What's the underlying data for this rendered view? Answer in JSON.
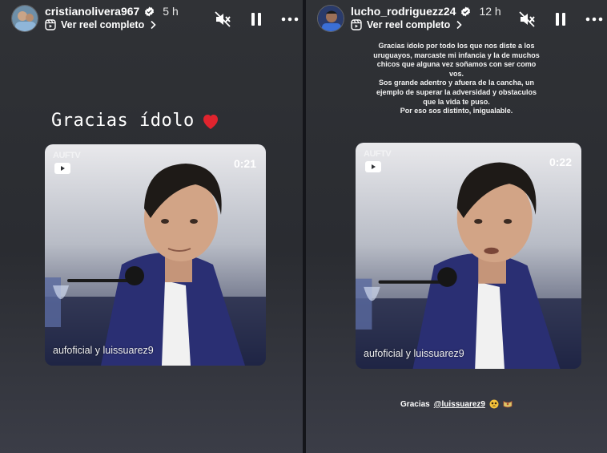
{
  "stories": [
    {
      "username": "cristianolivera967",
      "time": "5 h",
      "reel_link": "Ver reel completo",
      "headline": "Gracias ídolo",
      "video": {
        "logo": "AUFTV",
        "duration": "0:21",
        "credit": "aufoficial y luissuarez9"
      }
    },
    {
      "username": "lucho_rodriguezz24",
      "time": "12 h",
      "reel_link": "Ver reel completo",
      "caption": [
        "Gracias idolo por todo los que nos diste a los",
        "uruguayos, marcaste mi infancia y la de muchos",
        "chicos que alguna vez soñamos con ser como",
        "vos.",
        "Sos grande adentro y afuera de la cancha, un",
        "ejemplo de superar la adversidad y obstaculos",
        "que la vida te puso.",
        "Por eso sos distinto, inigualable."
      ],
      "video": {
        "logo": "AUFTV",
        "duration": "0:22",
        "credit": "aufoficial y luissuarez9"
      },
      "thanks_text": "Gracias",
      "mention": "@luissuarez9"
    }
  ],
  "icons": {
    "mute": "speaker-muted-icon",
    "pause": "pause-icon",
    "more": "more-options-icon",
    "verified": "verified-badge-icon",
    "reel": "reel-icon",
    "heart": "red-heart-icon"
  },
  "colors": {
    "background": "#2c2e33",
    "verified": "#ffffff",
    "heart": "#e0242e",
    "jacket": "#2a2f73"
  }
}
